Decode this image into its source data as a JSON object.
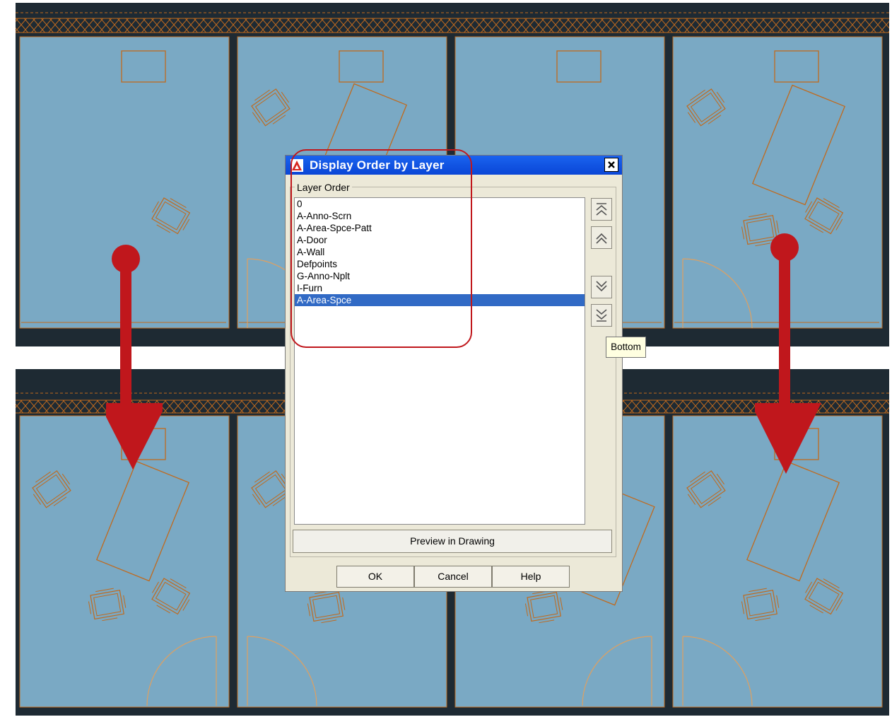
{
  "dialog": {
    "title": "Display Order by Layer",
    "group_label": "Layer Order",
    "layers": [
      "0",
      "A-Anno-Scrn",
      "A-Area-Spce-Patt",
      "A-Door",
      "A-Wall",
      "Defpoints",
      "G-Anno-Nplt",
      "I-Furn",
      "A-Area-Spce"
    ],
    "selected_layer": "A-Area-Spce",
    "side_buttons": [
      {
        "name": "move-to-top-button",
        "icon": "double-chevron-up-icon"
      },
      {
        "name": "move-up-button",
        "icon": "chevron-up-icon"
      },
      {
        "name": "move-down-button",
        "icon": "chevron-down-icon"
      },
      {
        "name": "move-to-bottom-button",
        "icon": "double-chevron-down-icon"
      }
    ],
    "tooltip": "Bottom",
    "preview_label": "Preview in Drawing",
    "ok_label": "OK",
    "cancel_label": "Cancel",
    "help_label": "Help",
    "close_icon": "close-icon",
    "app_icon": "autocad-icon"
  },
  "colors": {
    "room_fill": "#7aa9c4",
    "wall": "#1e2a33",
    "linework": "#c06a1e",
    "title_bar": "#0a46d6",
    "selection": "#316ac5",
    "annotation_red": "#c0171c"
  }
}
